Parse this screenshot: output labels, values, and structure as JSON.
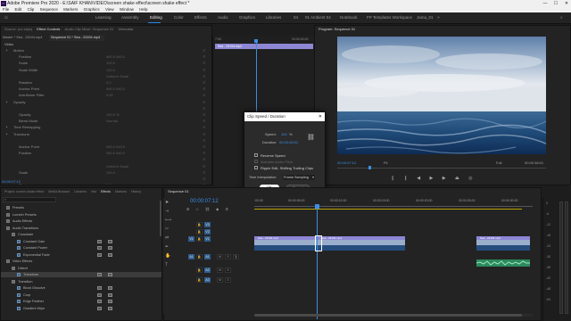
{
  "window": {
    "title": "Adobe Premiere Pro 2020 - E:\\SAIF KHAN\\VIDEO\\screen shake effect\\screen shake effect *",
    "minimize": "—",
    "maximize": "☐",
    "close": "✕"
  },
  "menu": [
    "File",
    "Edit",
    "Clip",
    "Sequence",
    "Markers",
    "Graphics",
    "View",
    "Window",
    "Help"
  ],
  "workspaces": [
    "Learning",
    "Assembly",
    "Editing",
    "Color",
    "Effects",
    "Audio",
    "Graphics",
    "Libraries",
    "04",
    "01 Ambient 04",
    "Notebook",
    "FP Templates Workspace",
    "Jama_01"
  ],
  "workspaces_active": "Editing",
  "effect_controls": {
    "tabs": [
      "Source: (no clips)",
      "Effect Controls",
      "Audio Clip Mixer: Sequence 01",
      "Metadata"
    ],
    "header_master": "Master * Sea - 23194.mp4",
    "header_seq": "Sequence 01 * Sea - 23194.mp4",
    "section_video": "Video",
    "rows": [
      {
        "label": "Motion",
        "indent": 1,
        "value": ""
      },
      {
        "label": "Position",
        "indent": 2,
        "value": "960.0   540.0"
      },
      {
        "label": "Scale",
        "indent": 2,
        "value": "100.0"
      },
      {
        "label": "Scale Width",
        "indent": 2,
        "value": "100.0"
      },
      {
        "label": "",
        "indent": 2,
        "value": "Uniform Scale"
      },
      {
        "label": "Rotation",
        "indent": 2,
        "value": "0.0"
      },
      {
        "label": "Anchor Point",
        "indent": 2,
        "value": "960.0   540.0"
      },
      {
        "label": "Anti-flicker Filter",
        "indent": 2,
        "value": "0.00"
      },
      {
        "label": "Opacity",
        "indent": 1,
        "value": ""
      },
      {
        "label": "",
        "indent": 2,
        "value": ""
      },
      {
        "label": "Opacity",
        "indent": 2,
        "value": "100.0 %"
      },
      {
        "label": "Blend Mode",
        "indent": 2,
        "value": "Normal"
      },
      {
        "label": "Time Remapping",
        "indent": 1,
        "value": ""
      },
      {
        "label": "Transform",
        "indent": 1,
        "value": ""
      },
      {
        "label": "",
        "indent": 2,
        "value": ""
      },
      {
        "label": "Anchor Point",
        "indent": 2,
        "value": "960.0   540.0"
      },
      {
        "label": "Position",
        "indent": 2,
        "value": "960.0   540.0"
      },
      {
        "label": "",
        "indent": 2,
        "value": ""
      },
      {
        "label": "",
        "indent": 2,
        "value": "Uniform Scale"
      },
      {
        "label": "Scale",
        "indent": 2,
        "value": "100.0"
      },
      {
        "label": "",
        "indent": 2,
        "value": ""
      },
      {
        "label": "Skew",
        "indent": 2,
        "value": "0.0"
      }
    ],
    "mini_timecode_left": "7:00",
    "mini_timecode_right": "00:00:00:00",
    "clip_label": "Sea - 23194.mp4",
    "bottom_timecode": "00:00:07:12"
  },
  "program_monitor": {
    "tab": "Program: Sequence 01",
    "timecode_left": "00:00:07:12",
    "fit": "Fit",
    "quality": "Full",
    "timecode_right": "00:00:38:01"
  },
  "dialog": {
    "title": "Clip Speed / Duration",
    "close": "✕",
    "speed_label": "Speed:",
    "speed_value": "100",
    "speed_unit": "%",
    "duration_label": "Duration:",
    "duration_value": "00:00:45:01",
    "reverse_speed": "Reverse Speed",
    "maintain_pitch": "Maintain Audio Pitch",
    "ripple_edit": "Ripple Edit, Shifting Trailing Clips",
    "time_interp_label": "Time Interpolation:",
    "time_interp_value": "Frame Sampling",
    "ok": "OK",
    "cancel": "Cancel"
  },
  "effects_panel": {
    "tabs": [
      "Project: screen shake effect",
      "Media Browser",
      "Libraries",
      "Info",
      "Effects",
      "Markers",
      "History"
    ],
    "tree": [
      {
        "label": "Presets",
        "indent": 0,
        "type": "folder"
      },
      {
        "label": "Lumetri Presets",
        "indent": 0,
        "type": "folder"
      },
      {
        "label": "Audio Effects",
        "indent": 0,
        "type": "folder"
      },
      {
        "label": "Audio Transitions",
        "indent": 0,
        "type": "folder"
      },
      {
        "label": "Crossfade",
        "indent": 1,
        "type": "folder"
      },
      {
        "label": "Constant Gain",
        "indent": 2,
        "type": "fx"
      },
      {
        "label": "Constant Power",
        "indent": 2,
        "type": "fx"
      },
      {
        "label": "Exponential Fade",
        "indent": 2,
        "type": "fx"
      },
      {
        "label": "Video Effects",
        "indent": 0,
        "type": "folder"
      },
      {
        "label": "Distort",
        "indent": 1,
        "type": "folder"
      },
      {
        "label": "Transform",
        "indent": 2,
        "type": "fx",
        "selected": true
      },
      {
        "label": "Transition",
        "indent": 1,
        "type": "folder"
      },
      {
        "label": "Block Dissolve",
        "indent": 2,
        "type": "fx"
      },
      {
        "label": "Crop",
        "indent": 2,
        "type": "fx"
      },
      {
        "label": "Edge Feather",
        "indent": 2,
        "type": "fx"
      },
      {
        "label": "Gradient Wipe",
        "indent": 2,
        "type": "fx"
      }
    ]
  },
  "timeline": {
    "tab": "Sequence 01",
    "timecode": "00:00:07:12",
    "ruler": [
      ":00:00",
      "00:00:05:00",
      "00:00:10:00",
      "00:00:15:00",
      "00:00:20:00",
      "00:00:25:00",
      "00:00:30:00"
    ],
    "video_tracks": [
      "V3",
      "V2",
      "V1"
    ],
    "audio_tracks": [
      "A1",
      "A2",
      "A3"
    ],
    "source_v": "V1",
    "source_a": "A1",
    "clips": [
      {
        "name": "Sea - 23194.mp4",
        "fx": "fx"
      },
      {
        "name": "Sea - 23194.mp4",
        "fx": "fx"
      },
      {
        "name": "Sea - 23194.mp4",
        "fx": "fx"
      },
      {
        "name": "Sea - 23194.mp4",
        "fx": "fx"
      },
      {
        "name": "Sea - 23194.mp4",
        "fx": "fx"
      }
    ],
    "meter_labels": [
      "0",
      "-6",
      "-12",
      "-18",
      "-24",
      "-30",
      "-36",
      "-42",
      "-48",
      "-54"
    ]
  }
}
